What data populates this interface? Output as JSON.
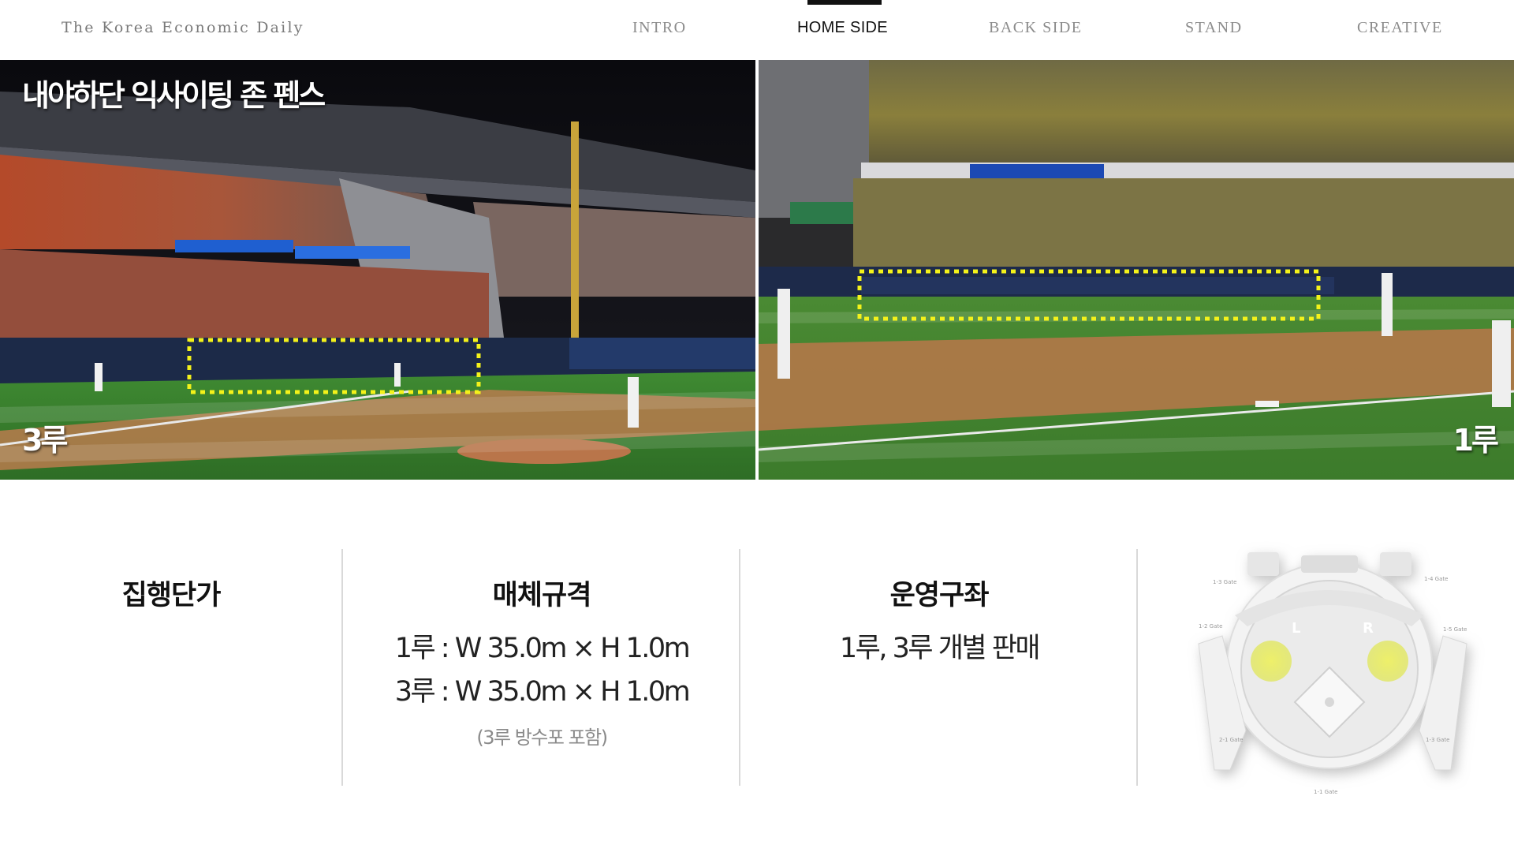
{
  "header": {
    "brand": "The Korea Economic Daily",
    "nav": [
      {
        "label": "INTRO",
        "active": false
      },
      {
        "label": "HOME SIDE",
        "active": true
      },
      {
        "label": "BACK SIDE",
        "active": false
      },
      {
        "label": "STAND",
        "active": false
      },
      {
        "label": "CREATIVE",
        "active": false
      }
    ]
  },
  "photos": {
    "title": "내야하단 익사이팅 존 펜스",
    "left_base": "3루",
    "right_base": "1루"
  },
  "info": {
    "price": {
      "heading": "집행단가"
    },
    "spec": {
      "heading": "매체규격",
      "line1": "1루 : W 35.0m × H 1.0m",
      "line2": "3루 : W 35.0m × H 1.0m",
      "note": "(3루 방수포 포함)"
    },
    "operation": {
      "heading": "운영구좌",
      "line1": "1루, 3루 개별 판매"
    }
  },
  "map": {
    "left_zone": "L",
    "right_zone": "R",
    "gates": [
      "1-3 Gate",
      "1-4 Gate",
      "1-2 Gate",
      "1-5 Gate",
      "2-1 Gate",
      "1-1 Gate",
      "1-3 Gate"
    ]
  },
  "colors": {
    "nav_active": "#111111",
    "highlight_dash": "#f2f21a",
    "map_zone": "#e6ee6a"
  }
}
